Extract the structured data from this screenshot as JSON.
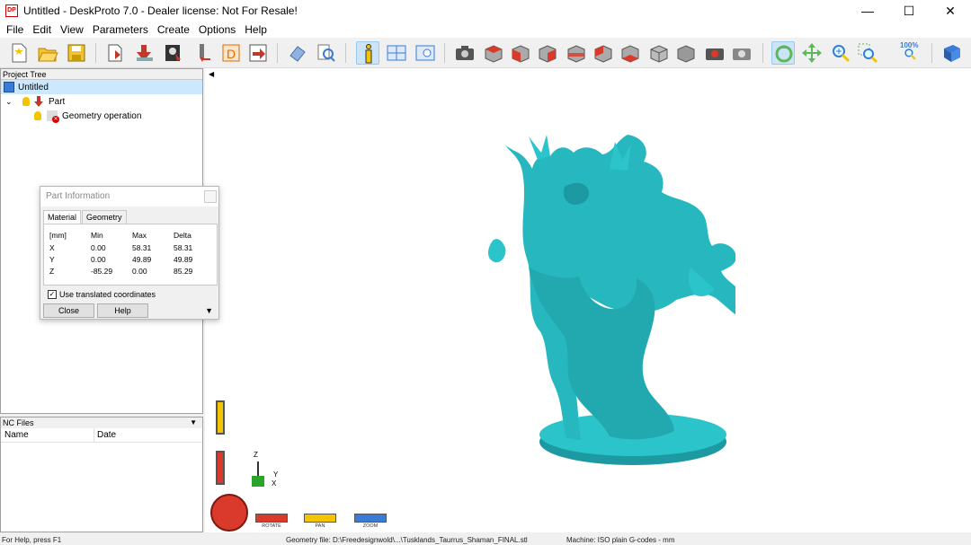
{
  "window": {
    "title": "Untitled - DeskProto 7.0 - Dealer license: Not For Resale!",
    "app_icon_text": "DP",
    "minimize": "—",
    "maximize": "☐",
    "close": "✕"
  },
  "menu": [
    "File",
    "Edit",
    "View",
    "Parameters",
    "Create",
    "Options",
    "Help"
  ],
  "toolbar": {
    "zoom_label": "100%"
  },
  "project_tree": {
    "header": "Project Tree",
    "root": "Untitled",
    "part": "Part",
    "operation": "Geometry operation"
  },
  "nc_files": {
    "header": "NC Files",
    "columns": [
      "Name",
      "Date"
    ]
  },
  "dialog": {
    "title": "Part Information",
    "tabs": [
      "Material",
      "Geometry"
    ],
    "active_tab": "Material",
    "headers": [
      "[mm]",
      "Min",
      "Max",
      "Delta"
    ],
    "rows": [
      [
        "X",
        "0.00",
        "58.31",
        "58.31"
      ],
      [
        "Y",
        "0.00",
        "49.89",
        "49.89"
      ],
      [
        "Z",
        "-85.29",
        "0.00",
        "85.29"
      ]
    ],
    "checkbox_label": "Use translated coordinates",
    "checkbox_checked": true,
    "close_label": "Close",
    "help_label": "Help"
  },
  "view_controls": {
    "rotate": "ROTATE",
    "pan": "PAN",
    "zoom": "ZOOM",
    "axis_z": "Z",
    "axis_y": "Y",
    "axis_x": "X"
  },
  "status": {
    "help": "For Help, press F1",
    "geometry_file": "Geometry file: D:\\Freedesignwold\\...\\Tusklands_Taurrus_Shaman_FINAL.stl",
    "machine": "Machine: ISO plain G-codes - mm"
  },
  "colors": {
    "model": "#27b8bf",
    "selection": "#cce8ff",
    "toolbar_active": "#cce4f7"
  }
}
